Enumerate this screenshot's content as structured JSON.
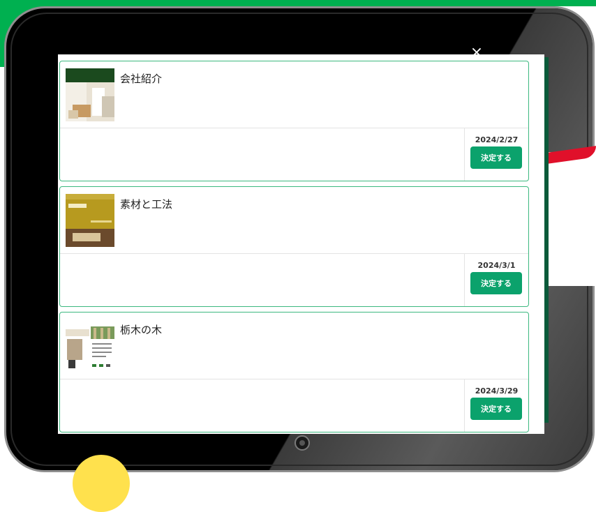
{
  "modal": {
    "close_symbol": "×",
    "items": [
      {
        "title": "会社紹介",
        "date": "2024/2/27",
        "button": "決定する",
        "thumb_style": "interior"
      },
      {
        "title": "素材と工法",
        "date": "2024/3/1",
        "button": "決定する",
        "thumb_style": "material"
      },
      {
        "title": "栃木の木",
        "date": "2024/3/29",
        "button": "決定する",
        "thumb_style": "leaflet"
      }
    ]
  },
  "colors": {
    "accent_green": "#0ba26c",
    "card_border": "#3cb87f",
    "header_green": "#00b050"
  }
}
